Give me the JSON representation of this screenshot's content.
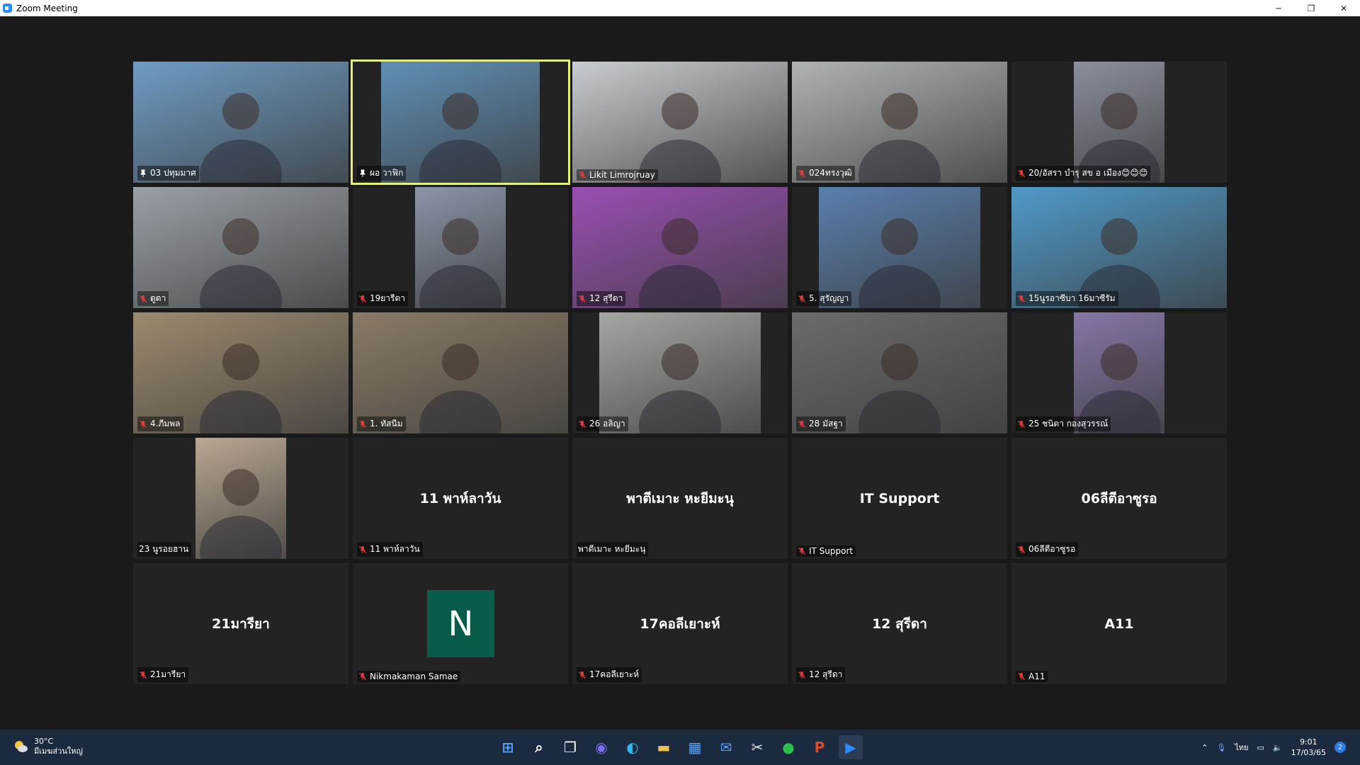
{
  "window": {
    "title": "Zoom Meeting",
    "minimize_glyph": "─",
    "restore_glyph": "❐",
    "close_glyph": "✕"
  },
  "participants": [
    {
      "name": "03 ปทุมมาศ",
      "display": "",
      "video": true,
      "mic": "pin",
      "video_color": "#6e9cc4"
    },
    {
      "name": "ผอ วาฟิก",
      "display": "",
      "video": true,
      "mic": "pin",
      "active": true,
      "video_color": "#5f8fb6"
    },
    {
      "name": "Likit Limrojruay",
      "display": "",
      "video": true,
      "mic": "muted",
      "video_color": "#c9ccd0"
    },
    {
      "name": "024ทรงวุฒิ",
      "display": "",
      "video": true,
      "mic": "muted",
      "video_color": "#b0b3b4"
    },
    {
      "name": "20/อัสรา  บำรุ สข อ เมือง😊😊😊",
      "display": "",
      "video": true,
      "mic": "muted",
      "video_color": "#8b8f9c"
    },
    {
      "name": "ดูดา",
      "display": "",
      "video": true,
      "mic": "muted",
      "video_color": "#9aa0a6"
    },
    {
      "name": "19ยารีดา",
      "display": "",
      "video": true,
      "mic": "muted",
      "video_color": "#8a95a7"
    },
    {
      "name": "12 สุรีดา",
      "display": "",
      "video": true,
      "mic": "muted",
      "video_color": "#9a4fb3"
    },
    {
      "name": "5. สุรัญญา",
      "display": "",
      "video": true,
      "mic": "muted",
      "video_color": "#5a7fae"
    },
    {
      "name": "15นูรอาซีบา 16มาซีรัม",
      "display": "",
      "video": true,
      "mic": "muted",
      "video_color": "#4f9ac9"
    },
    {
      "name": "4.ภีมพล",
      "display": "",
      "video": true,
      "mic": "muted",
      "video_color": "#9c8a6e"
    },
    {
      "name": "1. ทัสนีม",
      "display": "",
      "video": true,
      "mic": "muted",
      "video_color": "#8a7b66"
    },
    {
      "name": "26 อลิญา",
      "display": "",
      "video": true,
      "mic": "muted",
      "video_color": "#a6a6a2"
    },
    {
      "name": "28 มัสฐา",
      "display": "",
      "video": true,
      "mic": "muted",
      "video_color": "#6b6b6b"
    },
    {
      "name": "25 ชนิดา กองสุวรรณ์",
      "display": "",
      "video": true,
      "mic": "muted",
      "video_color": "#8676a8"
    },
    {
      "name": "23 นูรอยฮาน",
      "display": "",
      "video": true,
      "mic": "none",
      "video_color": "#b9a792"
    },
    {
      "name": "11 พาห์ลาวัน",
      "display": "11 พาห์ลาวัน",
      "video": false,
      "mic": "muted"
    },
    {
      "name": "พาตีเมาะ หะยีมะนุ",
      "display": "พาตีเมาะ หะยีมะนุ",
      "video": false,
      "mic": "none"
    },
    {
      "name": "IT Support",
      "display": "IT Support",
      "video": false,
      "mic": "muted"
    },
    {
      "name": "06ลีตีอาซูรอ",
      "display": "06ลีตีอาซูรอ",
      "video": false,
      "mic": "muted"
    },
    {
      "name": "21มารียา",
      "display": "21มารียา",
      "video": false,
      "mic": "muted"
    },
    {
      "name": "Nikmakaman Samae",
      "display": "",
      "video": false,
      "mic": "muted",
      "avatar_letter": "N"
    },
    {
      "name": "17คอลีเยาะห์",
      "display": "17คอลีเยาะห์",
      "video": false,
      "mic": "muted"
    },
    {
      "name": "12 สุรีดา",
      "display": "12 สุรีดา",
      "video": false,
      "mic": "muted"
    },
    {
      "name": "A11",
      "display": "A11",
      "video": false,
      "mic": "muted"
    }
  ],
  "taskbar": {
    "weather_temp": "30°C",
    "weather_desc": "มีเมฆส่วนใหญ่",
    "apps": [
      "start-icon",
      "search-icon",
      "task-view-icon",
      "chat-icon",
      "edge-icon",
      "file-explorer-icon",
      "store-icon",
      "mail-icon",
      "snipping-tool-icon",
      "line-icon",
      "powerpoint-icon",
      "zoom-icon"
    ],
    "language": "ไทย",
    "time": "9:01",
    "date": "17/03/65",
    "notifications": "2"
  },
  "colors": {
    "accent_active_speaker": "#e5f07a",
    "muted_mic": "#e03c3c",
    "avatar_bg": "#0a5c4a",
    "taskbar_bg": "#1b2a3f"
  }
}
